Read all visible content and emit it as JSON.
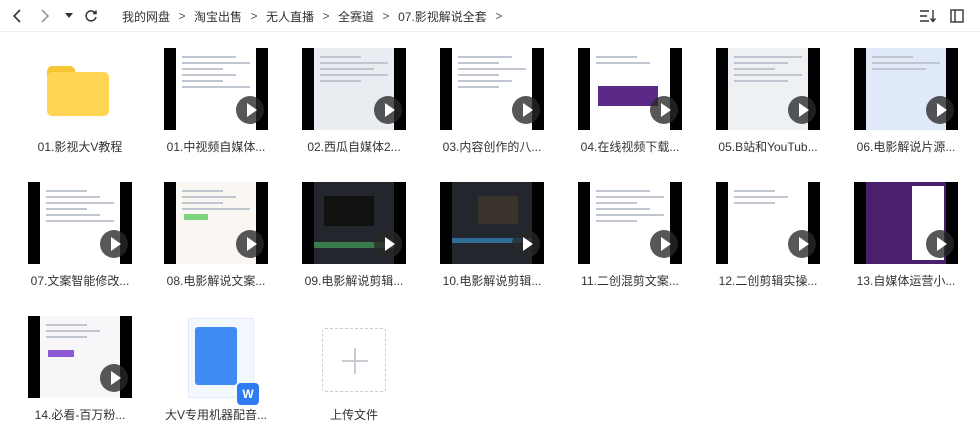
{
  "toolbar": {
    "back_icon": "chevron-left-icon",
    "forward_icon": "chevron-right-icon",
    "dropdown_icon": "caret-down-icon",
    "refresh_icon": "refresh-icon",
    "sort_icon": "sort-icon",
    "layout_icon": "layout-icon"
  },
  "breadcrumb": [
    {
      "label": "我的网盘"
    },
    {
      "label": "淘宝出售"
    },
    {
      "label": "无人直播"
    },
    {
      "label": "全赛道"
    },
    {
      "label": "07.影视解说全套"
    }
  ],
  "breadcrumb_separator": ">",
  "items": [
    {
      "label": "01.影视大V教程",
      "kind": "folder"
    },
    {
      "label": "01.中视频自媒体...",
      "kind": "video"
    },
    {
      "label": "02.西瓜自媒体2...",
      "kind": "video"
    },
    {
      "label": "03.内容创作的八...",
      "kind": "video"
    },
    {
      "label": "04.在线视频下载...",
      "kind": "video"
    },
    {
      "label": "05.B站和YouTub...",
      "kind": "video"
    },
    {
      "label": "06.电影解说片源...",
      "kind": "video"
    },
    {
      "label": "07.文案智能修改...",
      "kind": "video"
    },
    {
      "label": "08.电影解说文案...",
      "kind": "video"
    },
    {
      "label": "09.电影解说剪辑...",
      "kind": "video"
    },
    {
      "label": "10.电影解说剪辑...",
      "kind": "video"
    },
    {
      "label": "11.二创混剪文案...",
      "kind": "video"
    },
    {
      "label": "12.二创剪辑实操...",
      "kind": "video"
    },
    {
      "label": "13.自媒体运营小...",
      "kind": "video"
    },
    {
      "label": "14.必看-百万粉...",
      "kind": "video"
    },
    {
      "label": "大V专用机器配音...",
      "kind": "document",
      "badge": "W"
    },
    {
      "label": "上传文件",
      "kind": "upload"
    }
  ],
  "colors": {
    "folder": "#ffd553",
    "word_badge": "#2f7bf2",
    "border": "#eceff3"
  }
}
